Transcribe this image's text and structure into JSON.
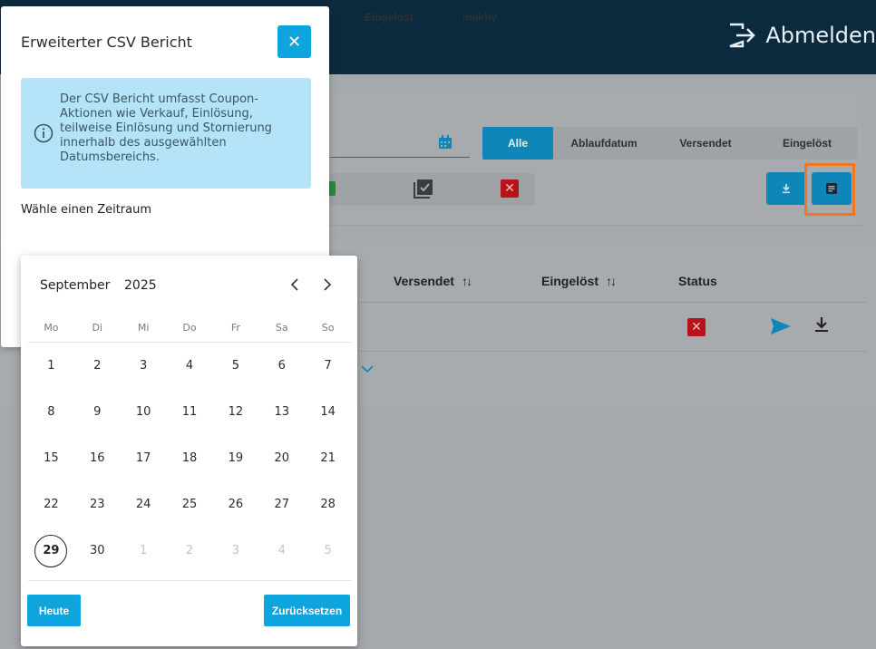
{
  "header": {
    "logout_label": "Abmelden"
  },
  "filters": {
    "segments": [
      "Alle",
      "Ablaufdatum",
      "Versendet",
      "Eingelöst"
    ],
    "status_labels": [
      "Eingelöst",
      "Inaktiv"
    ]
  },
  "table": {
    "headers": [
      "Versendet",
      "Eingelöst",
      "Status"
    ],
    "sort_glyph": "↑↓"
  },
  "modal": {
    "title": "Erweiterter CSV Bericht",
    "close_glyph": "✕",
    "info_text": "Der CSV Bericht umfasst Coupon-Aktionen wie Verkauf, Einlösung, teilweise Einlösung und Stornierung innerhalb des ausgewählten Datumsbereichs.",
    "period_label": "Wähle einen Zeitraum"
  },
  "datepicker": {
    "month": "September",
    "year": "2025",
    "prev_glyph": "‹",
    "next_glyph": "›",
    "weekdays": [
      "Mo",
      "Di",
      "Mi",
      "Do",
      "Fr",
      "Sa",
      "So"
    ],
    "weeks": [
      [
        "1",
        "2",
        "3",
        "4",
        "5",
        "6",
        "7"
      ],
      [
        "8",
        "9",
        "10",
        "11",
        "12",
        "13",
        "14"
      ],
      [
        "15",
        "16",
        "17",
        "18",
        "19",
        "20",
        "21"
      ],
      [
        "22",
        "23",
        "24",
        "25",
        "26",
        "27",
        "28"
      ],
      [
        "29",
        "30",
        "1",
        "2",
        "3",
        "4",
        "5"
      ]
    ],
    "today": "29",
    "today_button": "Heute",
    "reset_button": "Zurücksetzen"
  },
  "colors": {
    "primary": "#0ea4de",
    "highlight": "#f47521",
    "info_bg": "#b5e4f8",
    "header_bg": "#0c2a3e"
  }
}
